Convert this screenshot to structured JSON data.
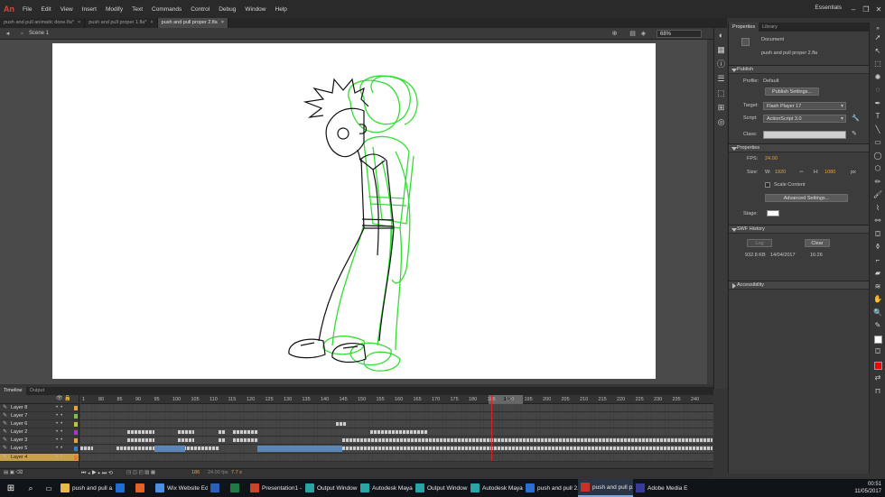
{
  "app": {
    "logo": "An"
  },
  "menu": [
    "File",
    "Edit",
    "View",
    "Insert",
    "Modify",
    "Text",
    "Commands",
    "Control",
    "Debug",
    "Window",
    "Help"
  ],
  "workspace": "Essentials",
  "window_controls": {
    "min": "–",
    "max": "❐",
    "close": "✕"
  },
  "doc_tabs": [
    {
      "label": "push and pull animatic done.fla*",
      "close": "×",
      "active": false
    },
    {
      "label": "push and pull proper 1.fla*",
      "close": "×",
      "active": false
    },
    {
      "label": "push and pull proper 2.fla",
      "close": "×",
      "active": true
    }
  ],
  "scene": {
    "name": "Scene 1",
    "zoom": "68%"
  },
  "properties": {
    "tabs": [
      "Properties",
      "Library"
    ],
    "doc_type": "Document",
    "doc_name": "push and pull proper 2.fla",
    "publish": {
      "header": "Publish",
      "profile_label": "Profile:",
      "profile_value": "Default",
      "settings_btn": "Publish Settings...",
      "target_label": "Target:",
      "target_value": "Flash Player 17",
      "script_label": "Script:",
      "script_value": "ActionScript 3.0",
      "class_label": "Class:"
    },
    "props": {
      "header": "Properties",
      "fps_label": "FPS:",
      "fps_value": "24.00",
      "size_label": "Size:",
      "w_label": "W:",
      "w_value": "1920",
      "h_label": "H:",
      "h_value": "1080",
      "unit": "px",
      "scale_label": "Scale Content",
      "advanced_btn": "Advanced Settings...",
      "stage_label": "Stage:"
    },
    "history": {
      "header": "SWF History",
      "log_btn": "Log",
      "clear_btn": "Clear",
      "size": "932.8 KB",
      "date": "14/04/2017",
      "time": "16:26"
    },
    "accessibility": {
      "header": "Accessibility"
    }
  },
  "timeline": {
    "tabs": [
      "Timeline",
      "Output"
    ],
    "ticks": [
      "1",
      "80",
      "85",
      "90",
      "95",
      "100",
      "105",
      "110",
      "115",
      "120",
      "125",
      "130",
      "135",
      "140",
      "145",
      "150",
      "155",
      "160",
      "165",
      "170",
      "175",
      "180",
      "185",
      "190",
      "195",
      "200",
      "205",
      "210",
      "215",
      "220",
      "225",
      "230",
      "235",
      "240"
    ],
    "playhead_frame": "186",
    "layers": [
      {
        "name": "Layer 8",
        "color": "#e8a23a",
        "selected": false
      },
      {
        "name": "Layer 7",
        "color": "#7dc23a",
        "selected": false
      },
      {
        "name": "Layer 6",
        "color": "#c2c23a",
        "selected": false
      },
      {
        "name": "Layer 2",
        "color": "#a23ac2",
        "selected": false
      },
      {
        "name": "Layer 3",
        "color": "#e8a23a",
        "selected": false
      },
      {
        "name": "Layer 5",
        "color": "#3a7dc2",
        "selected": false
      },
      {
        "name": "Layer 4",
        "color": "#e87a3a",
        "selected": true
      }
    ],
    "footer": {
      "frame": "186",
      "fps": "24.00 fps",
      "time": "7.7 s"
    }
  },
  "taskbar": {
    "items": [
      {
        "label": "push and pull a...",
        "color": "#e6b84a"
      },
      {
        "label": "",
        "color": "#1e6fd0"
      },
      {
        "label": "",
        "color": "#e0642a"
      },
      {
        "label": "Wix Website Edi...",
        "color": "#4a8fe0"
      },
      {
        "label": "",
        "color": "#2b5fb8"
      },
      {
        "label": "",
        "color": "#1f7a44"
      },
      {
        "label": "Presentation1 - ...",
        "color": "#c9442a"
      },
      {
        "label": "Output Window",
        "color": "#2aa5a5"
      },
      {
        "label": "Autodesk Maya...",
        "color": "#2aa5a5"
      },
      {
        "label": "Output Window",
        "color": "#2aa5a5"
      },
      {
        "label": "Autodesk Maya...",
        "color": "#2aa5a5"
      },
      {
        "label": "push and pull 2...",
        "color": "#2a6fd0"
      },
      {
        "label": "push and pull p...",
        "color": "#c9302a"
      },
      {
        "label": "Adobe Media E...",
        "color": "#3a3a9a"
      }
    ],
    "time": "00:51",
    "date": "11/05/2017"
  }
}
